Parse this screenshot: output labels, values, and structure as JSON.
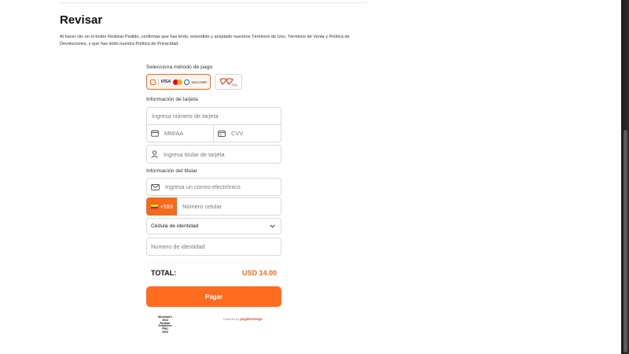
{
  "page": {
    "title": "Revisar",
    "terms_text": "Al hacer clic en el botón Realizar Pedido, confirmas que has leído, entendido y aceptado nuestros Términos de Uso, Términos de Venta y Política de Devoluciones, y que has leído nuestra Política de Privacidad."
  },
  "payment": {
    "method_label": "Selecciona método de pago",
    "methods": [
      {
        "name": "tarjeta",
        "brands": [
          "VISA",
          "mastercard",
          "diners",
          "DISCOVER"
        ],
        "selected": true
      },
      {
        "name": "app",
        "logo_text": "App",
        "selected": false
      }
    ],
    "card_section_label": "Información de tarjeta",
    "card_number_placeholder": "Ingresa número de tarjeta",
    "expiry_placeholder": "MM/AA",
    "cvv_placeholder": "CVV",
    "holder_placeholder": "Ingresa titular de tarjeta"
  },
  "holder": {
    "section_label": "Información del titular",
    "email_placeholder": "Ingresa un correo electrónico",
    "phone_prefix": "+593",
    "phone_placeholder": "Número celular",
    "id_type_selected": "Cédula de identidad",
    "id_number_placeholder": "Número de identidad"
  },
  "summary": {
    "total_label": "TOTAL:",
    "total_value": "USD 14.00",
    "pay_button": "Pagar"
  },
  "footer": {
    "badge_lines": [
      "Merchant's",
      "2024",
      "Realizar",
      "Surpasses",
      "PRO",
      "2024"
    ],
    "powered_prefix": "Powered by",
    "powered_brand": "payphonengo"
  },
  "colors": {
    "accent": "#f26a1b",
    "pay_button": "#ff6b1f",
    "border": "#d9d9d9",
    "flag": [
      "#ffd100",
      "#034ea2",
      "#ef3340"
    ]
  }
}
